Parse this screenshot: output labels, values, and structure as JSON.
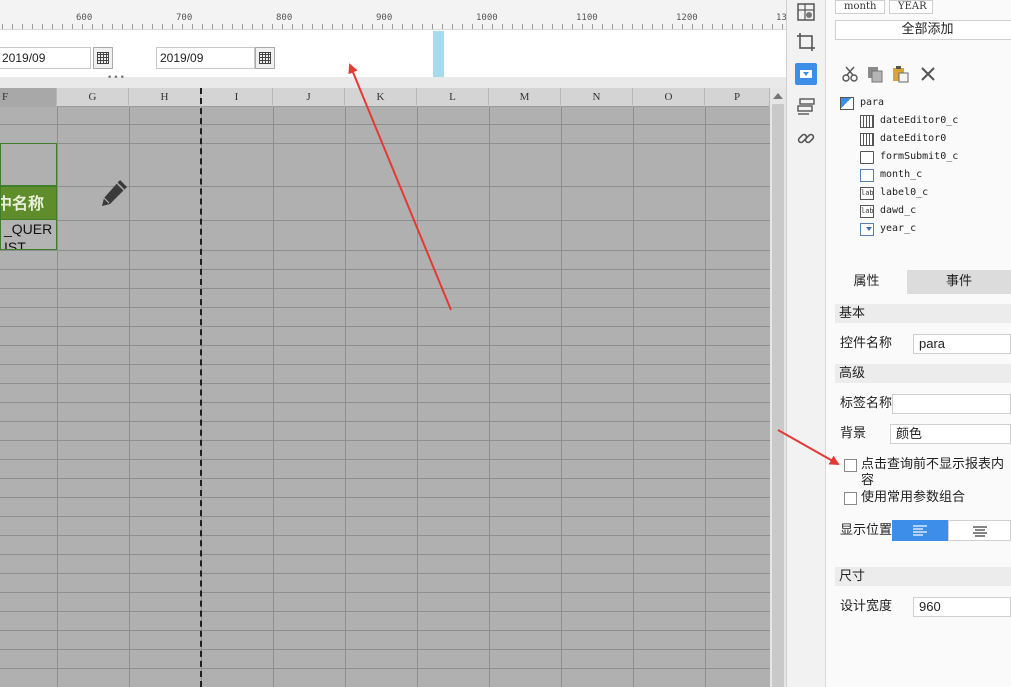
{
  "ruler": {
    "labels": [
      "600",
      "700",
      "800",
      "900",
      "1000",
      "1100",
      "1200",
      "13"
    ]
  },
  "params": {
    "date_editor_1_value": "2019/09",
    "date_editor_2_value": "2019/09"
  },
  "sheet": {
    "columns": [
      "F",
      "G",
      "H",
      "I",
      "J",
      "K",
      "L",
      "M",
      "N",
      "O",
      "P"
    ],
    "green_cell_text": "中名称",
    "query_cell_line1": "_QUER",
    "query_cell_line2": "IST"
  },
  "panel": {
    "pills": [
      "month",
      "YEAR"
    ],
    "add_all_label": "全部添加",
    "tree": {
      "root": "para",
      "children": [
        "dateEditor0_c",
        "dateEditor0",
        "formSubmit0_c",
        "month_c",
        "label0_c",
        "dawd_c",
        "year_c"
      ]
    },
    "tabs": {
      "properties": "属性",
      "events": "事件"
    },
    "sections": {
      "basic": "基本",
      "advanced": "高级",
      "size": "尺寸"
    },
    "fields": {
      "widget_name_label": "控件名称",
      "widget_name_value": "para",
      "tag_name_label": "标签名称",
      "tag_name_value": "",
      "background_label": "背景",
      "background_value": "颜色",
      "hide_before_query_label": "点击查询前不显示报表内容",
      "use_param_combo_label": "使用常用参数组合",
      "display_position_label": "显示位置",
      "design_width_label": "设计宽度",
      "design_width_value": "960"
    }
  },
  "colors": {
    "accent": "#3d8ee8",
    "sheet_bg": "#b0b0b0",
    "green_cell": "#5f8d2b",
    "annotation_arrow": "#e53935",
    "resize_bar": "#a6dbee"
  }
}
